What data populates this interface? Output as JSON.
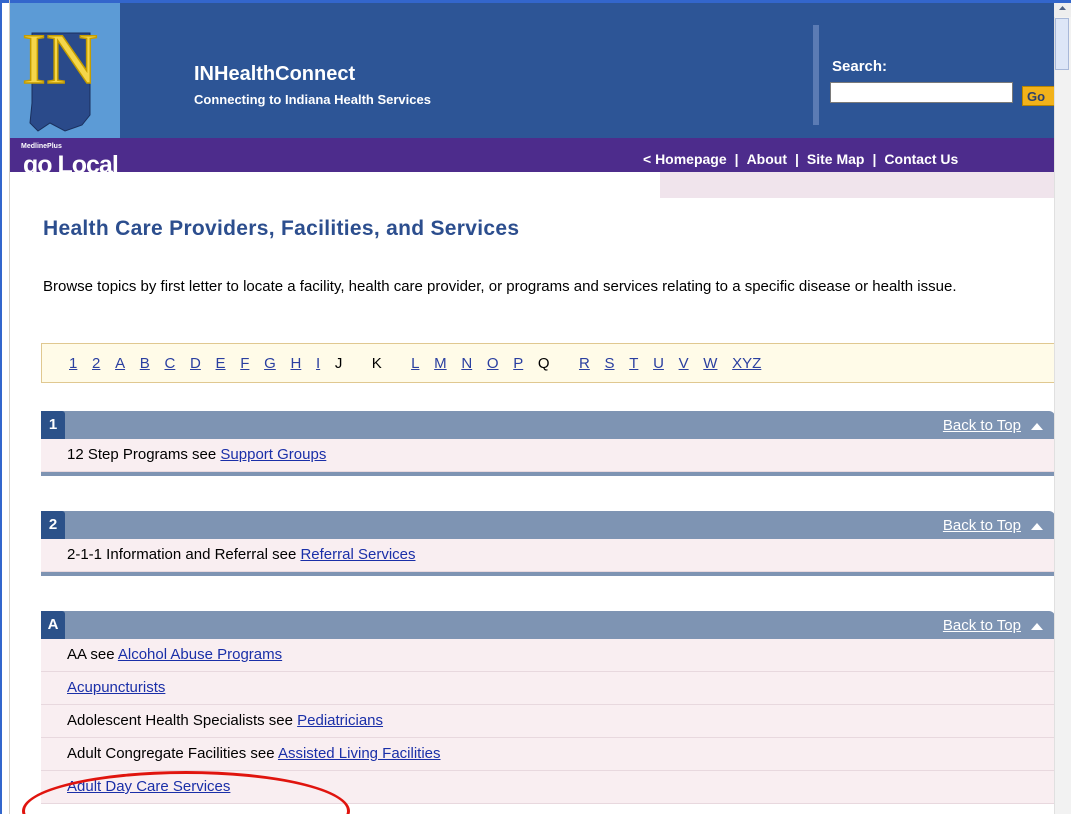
{
  "header": {
    "title": "INHealthConnect",
    "subtitle": "Connecting to Indiana Health Services",
    "logo_text": "IN",
    "search_label": "Search:",
    "search_value": "",
    "go_label": "Go"
  },
  "branding": {
    "medline": "MedlinePlus",
    "go_local": "go Local"
  },
  "nav": {
    "homepage": "< Homepage",
    "about": "About",
    "sitemap": "Site Map",
    "contact": "Contact Us",
    "separator": "|"
  },
  "page": {
    "title": "Health Care Providers, Facilities, and Services",
    "intro": "Browse topics by first letter to locate a facility, health care provider, or programs and services relating to a specific disease or health issue."
  },
  "alphabet": [
    {
      "label": "1",
      "link": true
    },
    {
      "label": "2",
      "link": true
    },
    {
      "label": "A",
      "link": true
    },
    {
      "label": "B",
      "link": true
    },
    {
      "label": "C",
      "link": true
    },
    {
      "label": "D",
      "link": true
    },
    {
      "label": "E",
      "link": true
    },
    {
      "label": "F",
      "link": true
    },
    {
      "label": "G",
      "link": true
    },
    {
      "label": "H",
      "link": true
    },
    {
      "label": "I",
      "link": true
    },
    {
      "label": "J",
      "link": false
    },
    {
      "label": "K",
      "link": false
    },
    {
      "label": "L",
      "link": true
    },
    {
      "label": "M",
      "link": true
    },
    {
      "label": "N",
      "link": true
    },
    {
      "label": "O",
      "link": true
    },
    {
      "label": "P",
      "link": true
    },
    {
      "label": "Q",
      "link": false
    },
    {
      "label": "R",
      "link": true
    },
    {
      "label": "S",
      "link": true
    },
    {
      "label": "T",
      "link": true
    },
    {
      "label": "U",
      "link": true
    },
    {
      "label": "V",
      "link": true
    },
    {
      "label": "W",
      "link": true
    },
    {
      "label": "XYZ",
      "link": true
    }
  ],
  "back_to_top": "Back to Top",
  "sections": [
    {
      "letter": "1",
      "items": [
        {
          "text": "12 Step Programs see ",
          "link": "Support Groups"
        }
      ]
    },
    {
      "letter": "2",
      "items": [
        {
          "text": "2-1-1 Information and Referral see ",
          "link": "Referral Services"
        }
      ]
    },
    {
      "letter": "A",
      "items": [
        {
          "text": "AA see ",
          "link": "Alcohol Abuse Programs"
        },
        {
          "text": "",
          "link": "Acupuncturists"
        },
        {
          "text": "Adolescent Health Specialists see ",
          "link": "Pediatricians"
        },
        {
          "text": "Adult Congregate Facilities see ",
          "link": "Assisted Living Facilities"
        },
        {
          "text": "",
          "link": "Adult Day Care Services"
        }
      ]
    }
  ],
  "colors": {
    "header_blue": "#2d5596",
    "nav_purple": "#4d2c8c",
    "section_bar": "#7e94b3",
    "highlight": "#e0140e"
  }
}
